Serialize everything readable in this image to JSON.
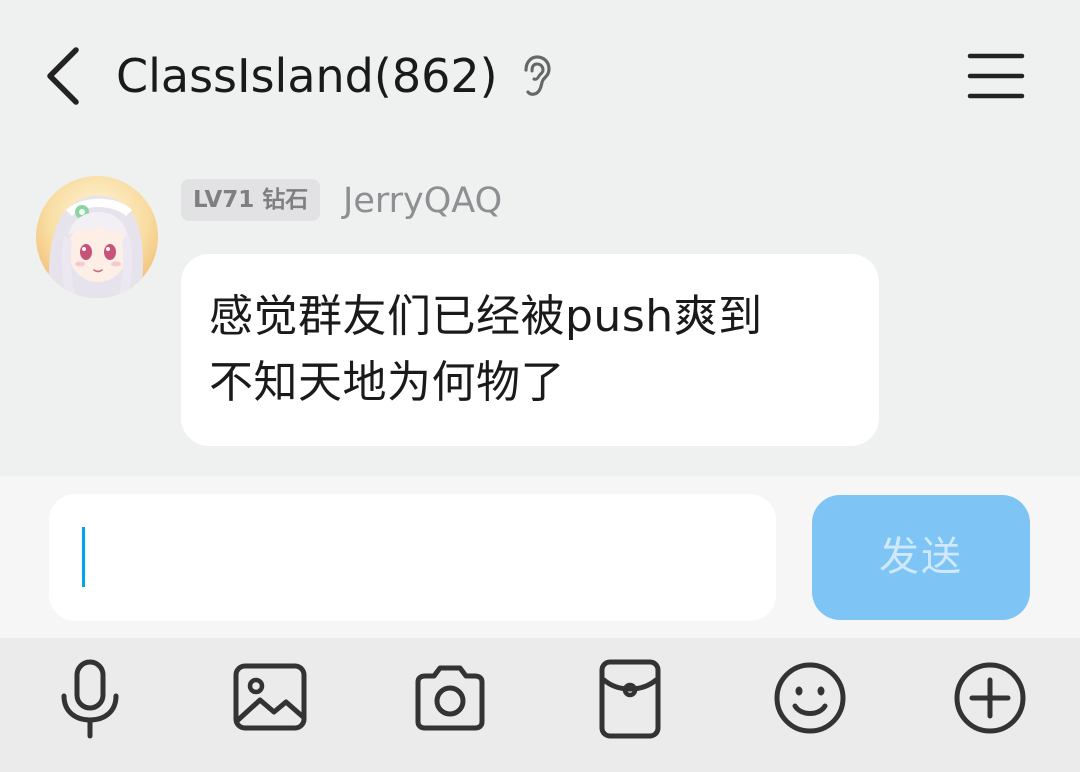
{
  "header": {
    "title": "ClassIsland(862)",
    "back_icon": "chevron-left-icon",
    "ear_icon": "ear-icon",
    "menu_icon": "hamburger-menu-icon"
  },
  "message": {
    "badge": "LV71 钻石",
    "sender": "JerryQAQ",
    "text_line1": "感觉群友们已经被push爽到",
    "text_line2": "不知天地为何物了"
  },
  "input": {
    "value": "",
    "send_label": "发送"
  },
  "toolbar": {
    "items": [
      "microphone-icon",
      "image-icon",
      "camera-icon",
      "red-packet-icon",
      "emoji-icon",
      "plus-icon"
    ]
  },
  "colors": {
    "background": "#eef1ef",
    "bubble": "#ffffff",
    "send_button": "#7ec5f6",
    "caret": "#00a6ea"
  }
}
